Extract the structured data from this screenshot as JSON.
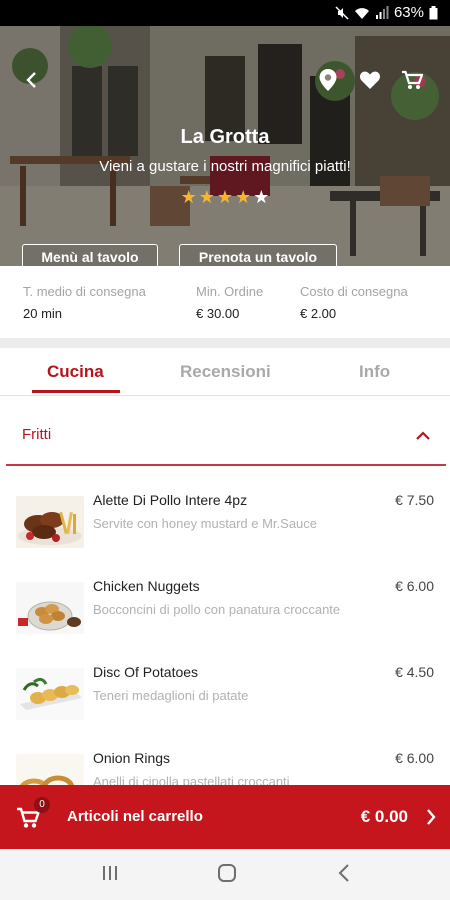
{
  "status_bar": {
    "battery": "63%"
  },
  "restaurant": {
    "name": "La Grotta",
    "tagline": "Vieni a gustare i nostri magnifici piatti!",
    "rating": 4,
    "max_rating": 5,
    "actions": [
      "Menù al tavolo",
      "Prenota un tavolo"
    ]
  },
  "delivery": [
    {
      "label": "T. medio di consegna",
      "value": "20 min"
    },
    {
      "label": "Min. Ordine",
      "value": "€ 30.00"
    },
    {
      "label": "Costo di consegna",
      "value": "€ 2.00"
    }
  ],
  "tabs": [
    {
      "label": "Cucina",
      "active": true
    },
    {
      "label": "Recensioni",
      "active": false
    },
    {
      "label": "Info",
      "active": false
    }
  ],
  "category": {
    "title": "Fritti",
    "expanded": true
  },
  "items": [
    {
      "name": "Alette Di Pollo Intere 4pz",
      "desc": "Servite con honey mustard e Mr.Sauce",
      "price": "€ 7.50",
      "thumb": "chicken-wings"
    },
    {
      "name": "Chicken Nuggets",
      "desc": "Bocconcini di pollo con panatura croccante",
      "price": "€ 6.00",
      "thumb": "nuggets"
    },
    {
      "name": "Disc Of Potatoes",
      "desc": "Teneri medaglioni di patate",
      "price": "€ 4.50",
      "thumb": "potato-discs"
    },
    {
      "name": "Onion Rings",
      "desc": "Anelli di cipolla pastellati croccanti",
      "price": "€ 6.00",
      "thumb": "onion-rings"
    }
  ],
  "cart": {
    "badge": "0",
    "label": "Articoli nel carrello",
    "total": "€ 0.00"
  },
  "colors": {
    "accent": "#b3161d",
    "cart_bg": "#c4161c",
    "star": "#f2b632"
  },
  "icons": {
    "back": "arrow-left-icon",
    "location": "map-pin-icon",
    "favorite": "heart-icon",
    "cart": "shopping-cart-icon",
    "collapse": "chevron-up-icon",
    "proceed": "chevron-right-icon"
  }
}
